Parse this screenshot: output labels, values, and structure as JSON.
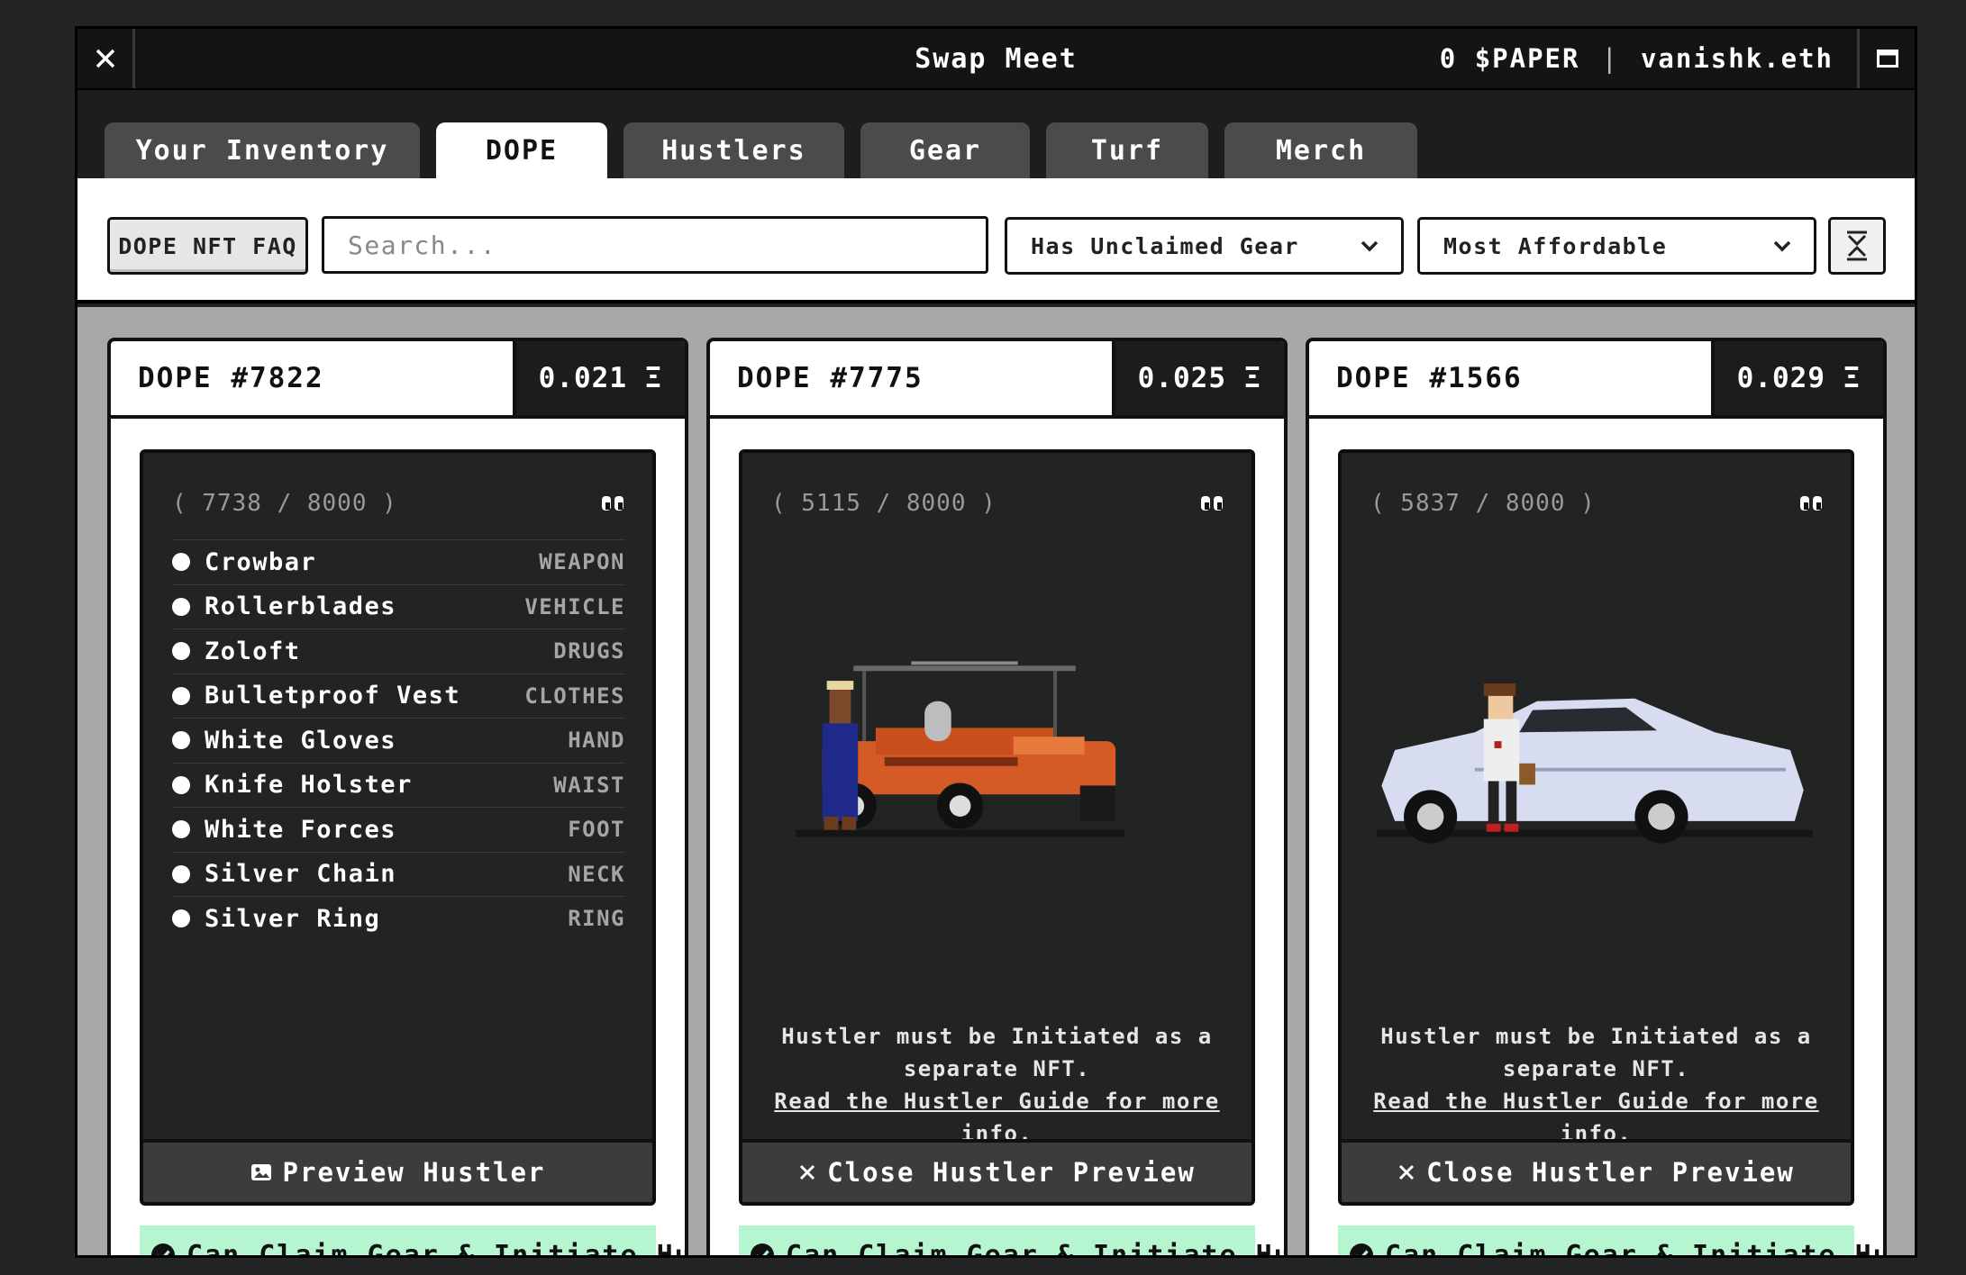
{
  "window": {
    "title": "Swap Meet",
    "balance": "0 $PAPER",
    "separator": "|",
    "account": "vanishk.eth",
    "close_icon": "close-icon",
    "maximize_icon": "maximize-icon"
  },
  "tabs": [
    {
      "label": "Your Inventory",
      "active": false
    },
    {
      "label": "DOPE",
      "active": true
    },
    {
      "label": "Hustlers",
      "active": false
    },
    {
      "label": "Gear",
      "active": false
    },
    {
      "label": "Turf",
      "active": false
    },
    {
      "label": "Merch",
      "active": false
    }
  ],
  "filters": {
    "faq_label": "DOPE NFT FAQ",
    "search_placeholder": "Search...",
    "filter_value": "Has Unclaimed Gear",
    "sort_value": "Most Affordable"
  },
  "cards": [
    {
      "title": "DOPE #7822",
      "price": "0.021 Ξ",
      "rank": "( 7738 / 8000 )",
      "items": [
        {
          "name": "Crowbar",
          "type": "WEAPON"
        },
        {
          "name": "Rollerblades",
          "type": "VEHICLE"
        },
        {
          "name": "Zoloft",
          "type": "DRUGS"
        },
        {
          "name": "Bulletproof Vest",
          "type": "CLOTHES"
        },
        {
          "name": "White Gloves",
          "type": "HAND"
        },
        {
          "name": "Knife Holster",
          "type": "WAIST"
        },
        {
          "name": "White Forces",
          "type": "FOOT"
        },
        {
          "name": "Silver Chain",
          "type": "NECK"
        },
        {
          "name": "Silver Ring",
          "type": "RING"
        }
      ],
      "button": "Preview Hustler",
      "claim": "Can Claim Gear & Initiate Hustler"
    },
    {
      "title": "DOPE #7775",
      "price": "0.025 Ξ",
      "rank": "( 5115 / 8000 )",
      "note": "Hustler must be Initiated as a separate NFT.",
      "link": "Read the Hustler Guide for more info.",
      "button": "Close Hustler Preview",
      "claim": "Can Claim Gear & Initiate Hustler"
    },
    {
      "title": "DOPE #1566",
      "price": "0.029 Ξ",
      "rank": "( 5837 / 8000 )",
      "note": "Hustler must be Initiated as a separate NFT.",
      "link": "Read the Hustler Guide for more info.",
      "button": "Close Hustler Preview",
      "claim": "Can Claim Gear & Initiate Hustler"
    }
  ],
  "colors": {
    "claim_bg": "#b5f5cf",
    "panel_bg": "#222323",
    "grid_bg": "#a8a8aa"
  }
}
